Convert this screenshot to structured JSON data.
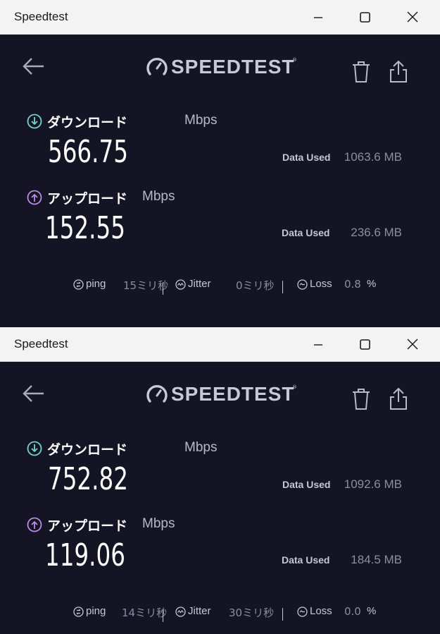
{
  "windows": [
    {
      "title": "Speedtest",
      "logo": "SPEEDTEST",
      "logo_tm": "®",
      "download": {
        "label": "ダウンロード",
        "unit": "Mbps",
        "value": "566.75",
        "data_used_label": "Data Used",
        "data_used": "1063.6 MB"
      },
      "upload": {
        "label": "アップロード",
        "unit": "Mbps",
        "value": "152.55",
        "data_used_label": "Data Used",
        "data_used": "236.6 MB"
      },
      "stats": {
        "ping_label": "ping",
        "ping_value": "15ミリ秒",
        "jitter_label": "Jitter",
        "jitter_value": "0ミリ秒",
        "loss_label": "Loss",
        "loss_value": "0.8",
        "loss_unit": "%"
      }
    },
    {
      "title": "Speedtest",
      "logo": "SPEEDTEST",
      "logo_tm": "®",
      "download": {
        "label": "ダウンロード",
        "unit": "Mbps",
        "value": "752.82",
        "data_used_label": "Data Used",
        "data_used": "1092.6 MB"
      },
      "upload": {
        "label": "アップロード",
        "unit": "Mbps",
        "value": "119.06",
        "data_used_label": "Data Used",
        "data_used": "184.5 MB"
      },
      "stats": {
        "ping_label": "ping",
        "ping_value": "14ミリ秒",
        "jitter_label": "Jitter",
        "jitter_value": "30ミリ秒",
        "loss_label": "Loss",
        "loss_value": "0.0",
        "loss_unit": "%"
      }
    }
  ],
  "icons": {
    "minimize": "minimize-icon",
    "maximize": "maximize-icon",
    "close": "close-icon",
    "back": "back-arrow-icon",
    "logo": "speedometer-icon",
    "trash": "trash-icon",
    "share": "share-icon",
    "download": "download-arrow-icon",
    "upload": "upload-arrow-icon",
    "ping": "ping-icon",
    "jitter": "jitter-icon",
    "loss": "loss-icon"
  },
  "colors": {
    "app_background": "#141424",
    "titlebar": "#f3f3f3",
    "download_accent": "#6fd6d0",
    "upload_accent": "#b98bea",
    "text_primary": "#ffffff",
    "text_muted": "#8d8da0"
  }
}
